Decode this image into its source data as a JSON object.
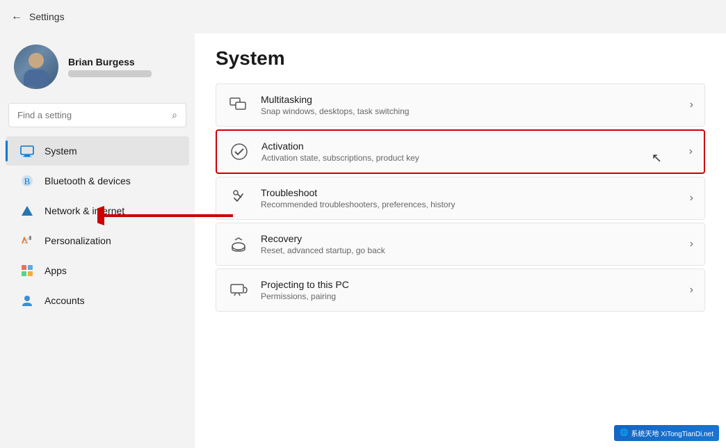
{
  "topbar": {
    "back_label": "←",
    "title": "Settings"
  },
  "sidebar": {
    "profile": {
      "name": "Brian Burgess"
    },
    "search": {
      "placeholder": "Find a setting"
    },
    "nav_items": [
      {
        "id": "system",
        "label": "System",
        "active": true,
        "icon": "monitor"
      },
      {
        "id": "bluetooth",
        "label": "Bluetooth & devices",
        "active": false,
        "icon": "bluetooth"
      },
      {
        "id": "network",
        "label": "Network & internet",
        "active": false,
        "icon": "network"
      },
      {
        "id": "personalization",
        "label": "Personalization",
        "active": false,
        "icon": "paint"
      },
      {
        "id": "apps",
        "label": "Apps",
        "active": false,
        "icon": "apps"
      },
      {
        "id": "accounts",
        "label": "Accounts",
        "active": false,
        "icon": "person"
      }
    ]
  },
  "content": {
    "title": "System",
    "settings": [
      {
        "id": "multitasking",
        "name": "Multitasking",
        "description": "Snap windows, desktops, task switching",
        "highlighted": false
      },
      {
        "id": "activation",
        "name": "Activation",
        "description": "Activation state, subscriptions, product key",
        "highlighted": true
      },
      {
        "id": "troubleshoot",
        "name": "Troubleshoot",
        "description": "Recommended troubleshooters, preferences, history",
        "highlighted": false
      },
      {
        "id": "recovery",
        "name": "Recovery",
        "description": "Reset, advanced startup, go back",
        "highlighted": false
      },
      {
        "id": "projecting",
        "name": "Projecting to this PC",
        "description": "Permissions, pairing",
        "highlighted": false
      }
    ]
  },
  "watermark": {
    "text": "系统天地",
    "subtext": "XiTongTianDi.net"
  }
}
